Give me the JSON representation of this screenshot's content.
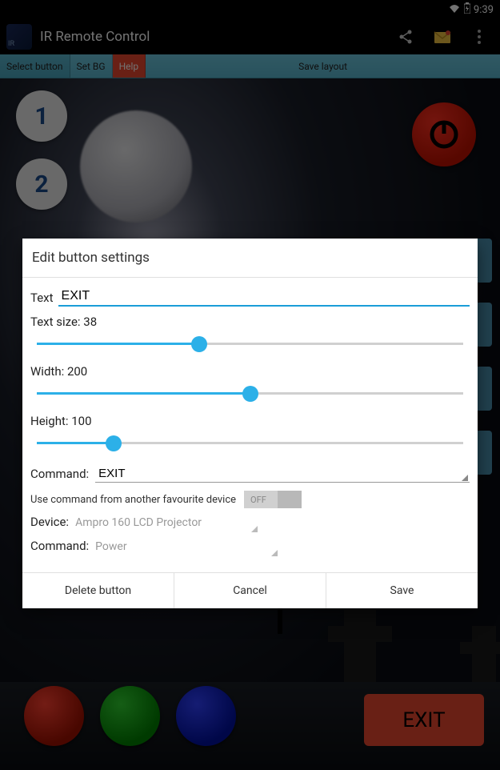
{
  "status": {
    "time": "9:39"
  },
  "app": {
    "title": "IR Remote Control",
    "icon_label": "IR"
  },
  "toolbar": {
    "select": "Select button",
    "setbg": "Set BG",
    "help": "Help",
    "save": "Save layout"
  },
  "remote": {
    "btn1": "1",
    "btn2": "2",
    "exit": "EXIT"
  },
  "dialog": {
    "title": "Edit button settings",
    "text_label": "Text",
    "text_value": "EXIT",
    "size_label": "Text size: 38",
    "size_value": 38,
    "size_pct": 38,
    "width_label": "Width: 200",
    "width_value": 200,
    "width_pct": 50,
    "height_label": "Height: 100",
    "height_value": 100,
    "height_pct": 18,
    "command_label": "Command:",
    "command_value": "EXIT",
    "fav_label": "Use command from another favourite device",
    "fav_toggle": "OFF",
    "device_label": "Device:",
    "device_value": "Ampro 160 LCD Projector",
    "command2_label": "Command:",
    "command2_value": "Power",
    "actions": {
      "delete": "Delete button",
      "cancel": "Cancel",
      "save": "Save"
    }
  }
}
